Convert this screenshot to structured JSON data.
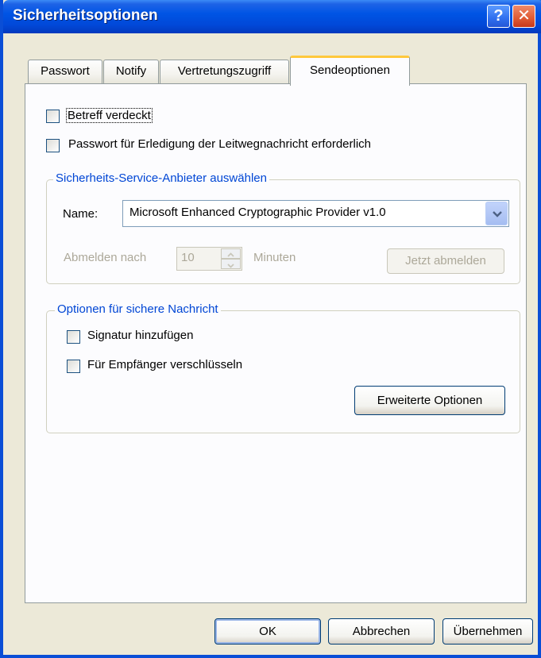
{
  "window": {
    "title": "Sicherheitsoptionen",
    "help_glyph": "?",
    "close_glyph": "✕"
  },
  "tabs": [
    {
      "label": "Passwort"
    },
    {
      "label": "Notify"
    },
    {
      "label": "Vertretungszugriff"
    },
    {
      "label": "Sendeoptionen",
      "active": true
    }
  ],
  "options": {
    "betreff_verdeckt": {
      "label": "Betreff verdeckt",
      "checked": false
    },
    "passwort_erledigung": {
      "label": "Passwort für Erledigung der Leitwegnachricht erforderlich",
      "checked": false
    }
  },
  "provider_group": {
    "caption": "Sicherheits-Service-Anbieter auswählen",
    "name_label": "Name:",
    "provider_value": "Microsoft Enhanced Cryptographic Provider v1.0",
    "abmelden_label": "Abmelden nach",
    "minutes_value": "10",
    "minuten_label": "Minuten",
    "jetzt_abmelden": "Jetzt abmelden"
  },
  "secure_group": {
    "caption": "Optionen für sichere Nachricht",
    "signatur": {
      "label": "Signatur hinzufügen",
      "checked": false
    },
    "verschluesseln": {
      "label": "Für Empfänger verschlüsseln",
      "checked": false
    },
    "erweiterte": "Erweiterte Optionen"
  },
  "buttons": {
    "ok": "OK",
    "abbrechen": "Abbrechen",
    "uebernehmen": "Übernehmen"
  },
  "colors": {
    "titlebar": "#0055e5",
    "face": "#ece9d8",
    "group_caption": "#0046d5",
    "active_tab_accent": "#ffc83c"
  }
}
